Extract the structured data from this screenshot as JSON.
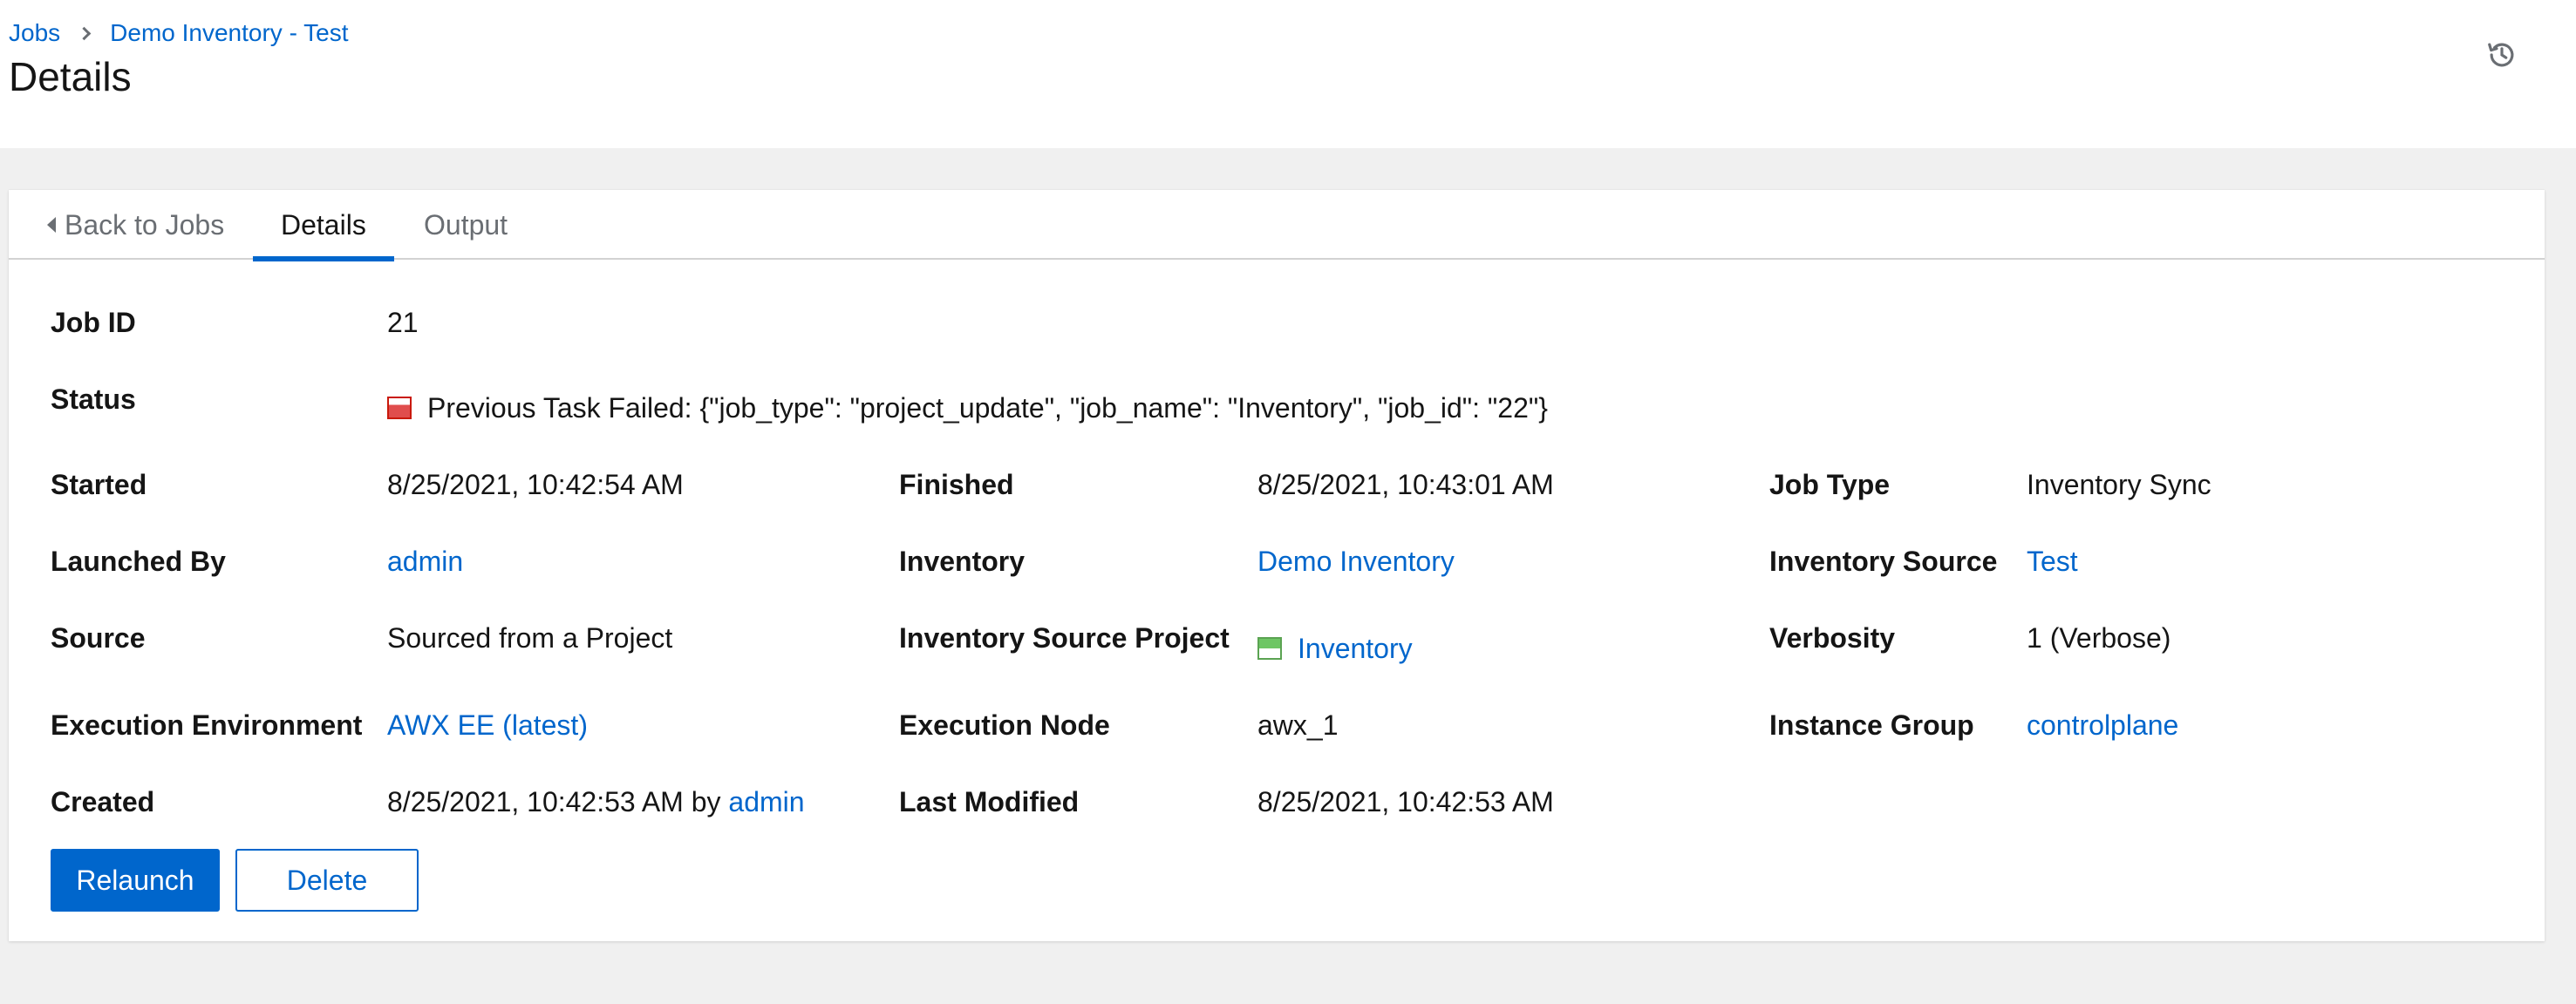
{
  "breadcrumb": {
    "items": [
      "Jobs",
      "Demo Inventory - Test"
    ]
  },
  "page_title": "Details",
  "icons": {
    "history": "history-icon",
    "back": "caret-left-icon",
    "status": "failed-status-icon",
    "project_status": "successful-status-icon"
  },
  "tabs": [
    {
      "label": "Back to Jobs",
      "active": false
    },
    {
      "label": "Details",
      "active": true
    },
    {
      "label": "Output",
      "active": false
    }
  ],
  "details": {
    "job_id": {
      "label": "Job ID",
      "value": "21"
    },
    "status": {
      "label": "Status",
      "value": "Previous Task Failed: {\"job_type\": \"project_update\", \"job_name\": \"Inventory\", \"job_id\": \"22\"}"
    },
    "started": {
      "label": "Started",
      "value": "8/25/2021, 10:42:54 AM"
    },
    "finished": {
      "label": "Finished",
      "value": "8/25/2021, 10:43:01 AM"
    },
    "job_type": {
      "label": "Job Type",
      "value": "Inventory Sync"
    },
    "launched_by": {
      "label": "Launched By",
      "value": "admin"
    },
    "inventory": {
      "label": "Inventory",
      "value": "Demo Inventory"
    },
    "inventory_source": {
      "label": "Inventory Source",
      "value": "Test"
    },
    "source": {
      "label": "Source",
      "value": "Sourced from a Project"
    },
    "inventory_source_project": {
      "label": "Inventory Source Project",
      "value": "Inventory"
    },
    "verbosity": {
      "label": "Verbosity",
      "value": "1 (Verbose)"
    },
    "execution_environment": {
      "label": "Execution Environment",
      "value": "AWX EE (latest)"
    },
    "execution_node": {
      "label": "Execution Node",
      "value": "awx_1"
    },
    "instance_group": {
      "label": "Instance Group",
      "value": "controlplane"
    },
    "created": {
      "label": "Created",
      "date": "8/25/2021, 10:42:53 AM",
      "by_text": "by",
      "user": "admin"
    },
    "last_modified": {
      "label": "Last Modified",
      "value": "8/25/2021, 10:42:53 AM"
    }
  },
  "actions": {
    "relaunch": "Relaunch",
    "delete": "Delete"
  },
  "colors": {
    "link": "#0066cc",
    "failed": "#e04d4d",
    "success": "#6ec664"
  }
}
